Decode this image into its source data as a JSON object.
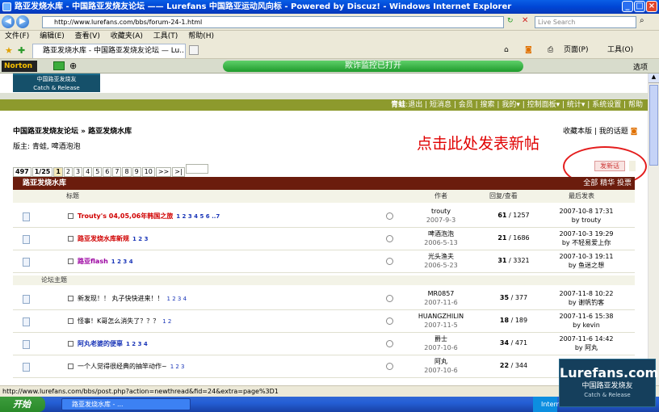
{
  "window": {
    "title": "路亚发烧水库 - 中国路亚发烧友论坛 —— Lurefans 中国路亚运动风向标 - Powered by Discuz! - Windows Internet Explorer",
    "buttons": {
      "minimize": "_",
      "maximize": "□",
      "close": "×"
    }
  },
  "address": {
    "url": "http://www.lurefans.com/bbs/forum-24-1.html",
    "search_placeholder": "Live Search"
  },
  "menu": {
    "items": [
      "文件(F)",
      "编辑(E)",
      "查看(V)",
      "收藏夹(A)",
      "工具(T)",
      "帮助(H)"
    ]
  },
  "tabs": {
    "active": "路亚发烧水库 - 中国路亚发烧友论坛 — Lu..."
  },
  "toolbar": {
    "page_label": "页面(P)",
    "tools_label": "工具(O)"
  },
  "norton": {
    "logo": "Norton",
    "banner": "欺诈监控已打开",
    "options": "选项"
  },
  "forum": {
    "logo_cn": "中国路亚发烧友",
    "logo_en": "Catch & Release",
    "nav": {
      "user": "青蛙",
      "items": [
        "退出",
        "短消息",
        "会员",
        "搜索",
        "我的",
        "控制面板",
        "统计",
        "系统设置",
        "帮助"
      ]
    },
    "breadcrumb": "中国路亚发烧友论坛 » 路亚发烧水库",
    "breadcrumb_right": "收藏本版 | 我的话题",
    "moderators": "版主: 青蛙, 啤酒泡泡",
    "annotation": "点击此处发表新帖",
    "post_button": "发新话",
    "pagination": {
      "total": "497",
      "pageinfo": "1/25",
      "current": "1",
      "pages": [
        "2",
        "3",
        "4",
        "5",
        "6",
        "7",
        "8",
        "9",
        "10"
      ],
      "next": ">>",
      "last": ">|"
    },
    "board_title": "路亚发烧水库",
    "filters": "全部 精华 投票",
    "columns": {
      "title": "标题",
      "author": "作者",
      "replies_views": "回复/查看",
      "last_post": "最后发表"
    },
    "section_label": "论坛主题",
    "threads": [
      {
        "title": "Trouty's 04,05,06年韩国之旅",
        "style": "sticky",
        "pages": "1 2 3 4 5 6 ..7",
        "author": "trouty",
        "date": "2007-9-3",
        "replies": "61",
        "views": "1257",
        "last_time": "2007-10-8 17:31",
        "last_by": "by trouty"
      },
      {
        "title": "路亚发烧水库新规",
        "style": "sticky",
        "pages": "1 2 3",
        "author": "啤酒泡泡",
        "date": "2006-5-13",
        "replies": "21",
        "views": "1686",
        "last_time": "2007-10-3 19:29",
        "last_by": "by 不轻易爱上你"
      },
      {
        "title": "路亚flash",
        "style": "digest",
        "pages": "1 2 3 4",
        "author": "光头渔夫",
        "date": "2006-5-23",
        "replies": "31",
        "views": "3321",
        "last_time": "2007-10-3 19:11",
        "last_by": "by 鱼迷之想"
      },
      {
        "title": "新发现！！ 丸子快快进来！！",
        "style": "normal",
        "pages": "1 2 3 4",
        "author": "MR0857",
        "date": "2007-11-6",
        "replies": "35",
        "views": "377",
        "last_time": "2007-11-8 10:22",
        "last_by": "by 谢帆钓客"
      },
      {
        "title": "怪事！K哥怎么消失了？？？",
        "style": "normal",
        "pages": "1 2",
        "author": "HUANGZHILIN",
        "date": "2007-11-5",
        "replies": "18",
        "views": "189",
        "last_time": "2007-11-6 15:38",
        "last_by": "by kevin"
      },
      {
        "title": "阿丸老婆的便辜",
        "style": "bold",
        "pages": "1 2 3 4",
        "author": "爵士",
        "date": "2007-10-6",
        "replies": "34",
        "views": "471",
        "last_time": "2007-11-6 14:42",
        "last_by": "by 阿丸"
      },
      {
        "title": "一个人觉得很经典的抽竿动作~",
        "style": "normal",
        "pages": "1 2 3",
        "author": "阿丸",
        "date": "2007-10-6",
        "replies": "22",
        "views": "344",
        "last_time": "",
        "last_by": ""
      }
    ]
  },
  "statusbar": {
    "text": "http://www.lurefans.com/bbs/post.php?action=newthread&fid=24&extra=page%3D1"
  },
  "taskbar": {
    "start": "开始",
    "item": "路亚发烧水库 - ...",
    "tray": "Intern"
  },
  "watermark": {
    "brand": "Lurefans.com",
    "cn": "中国路亚发烧友",
    "en": "Catch & Release"
  }
}
